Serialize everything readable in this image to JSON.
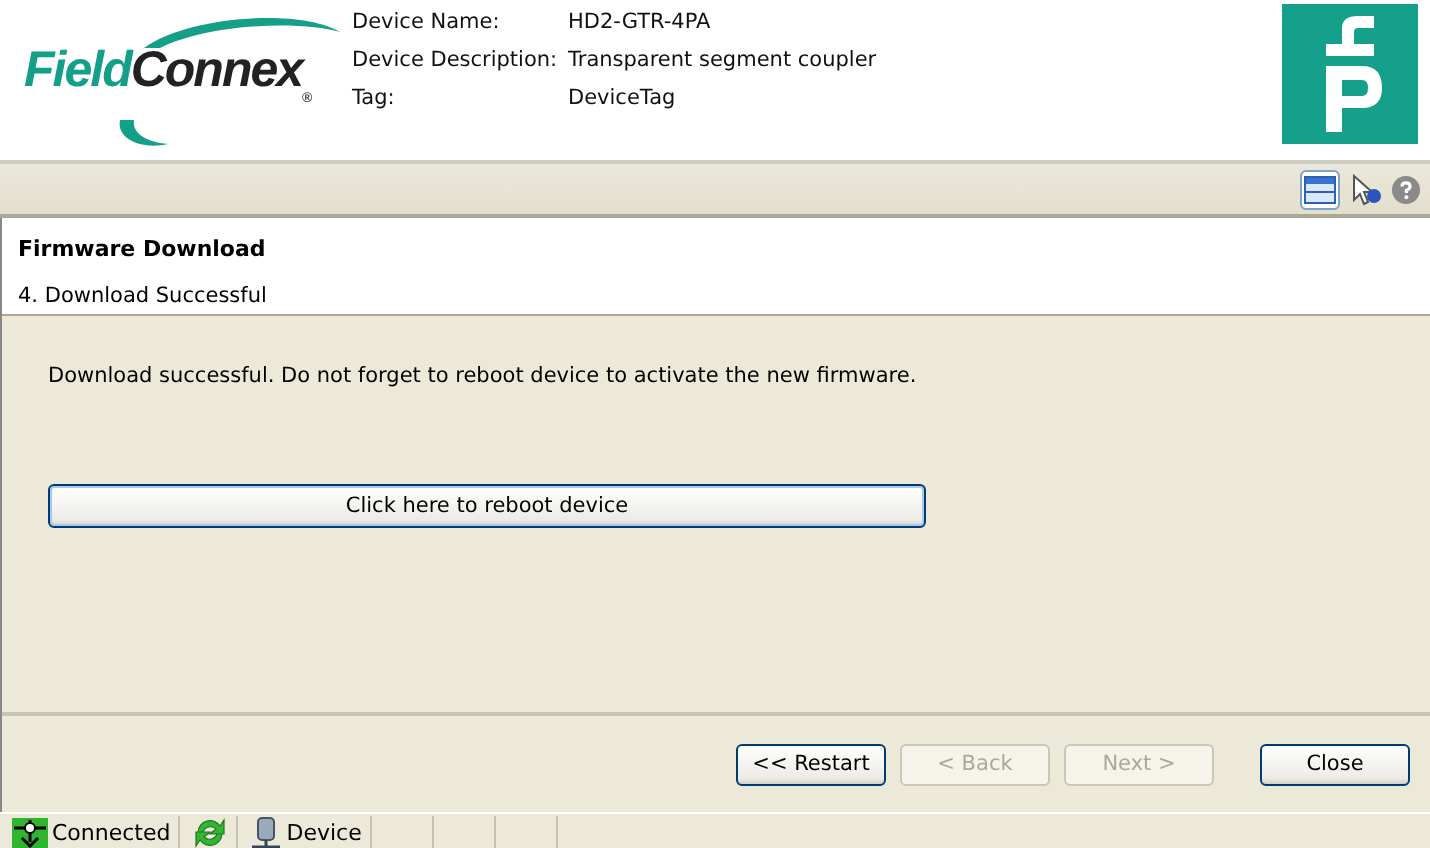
{
  "logo": {
    "part_1": "Field",
    "part_2": "Connex",
    "mark": "®"
  },
  "device_info": [
    {
      "label": "Device Name:",
      "value": "HD2-GTR-4PA"
    },
    {
      "label": "Device Description:",
      "value": "Transparent segment coupler"
    },
    {
      "label": "Tag:",
      "value": "DeviceTag"
    }
  ],
  "toolbar": {
    "view_toggle_selected": true
  },
  "wizard": {
    "title": "Firmware Download",
    "step": "4. Download Successful",
    "message": "Download successful. Do not forget to reboot device to activate the new firmware.",
    "action_button": "Click here to reboot device",
    "buttons": [
      {
        "label": "<< Restart",
        "disabled": false,
        "default": false
      },
      {
        "label": "< Back",
        "disabled": true,
        "default": false
      },
      {
        "label": "Next >",
        "disabled": true,
        "default": false
      },
      {
        "label": "Close",
        "disabled": false,
        "default": false
      }
    ]
  },
  "status_bar": [
    {
      "kind": "connection",
      "label": "Connected"
    },
    {
      "kind": "refresh"
    },
    {
      "kind": "device",
      "label": "Device"
    }
  ]
}
